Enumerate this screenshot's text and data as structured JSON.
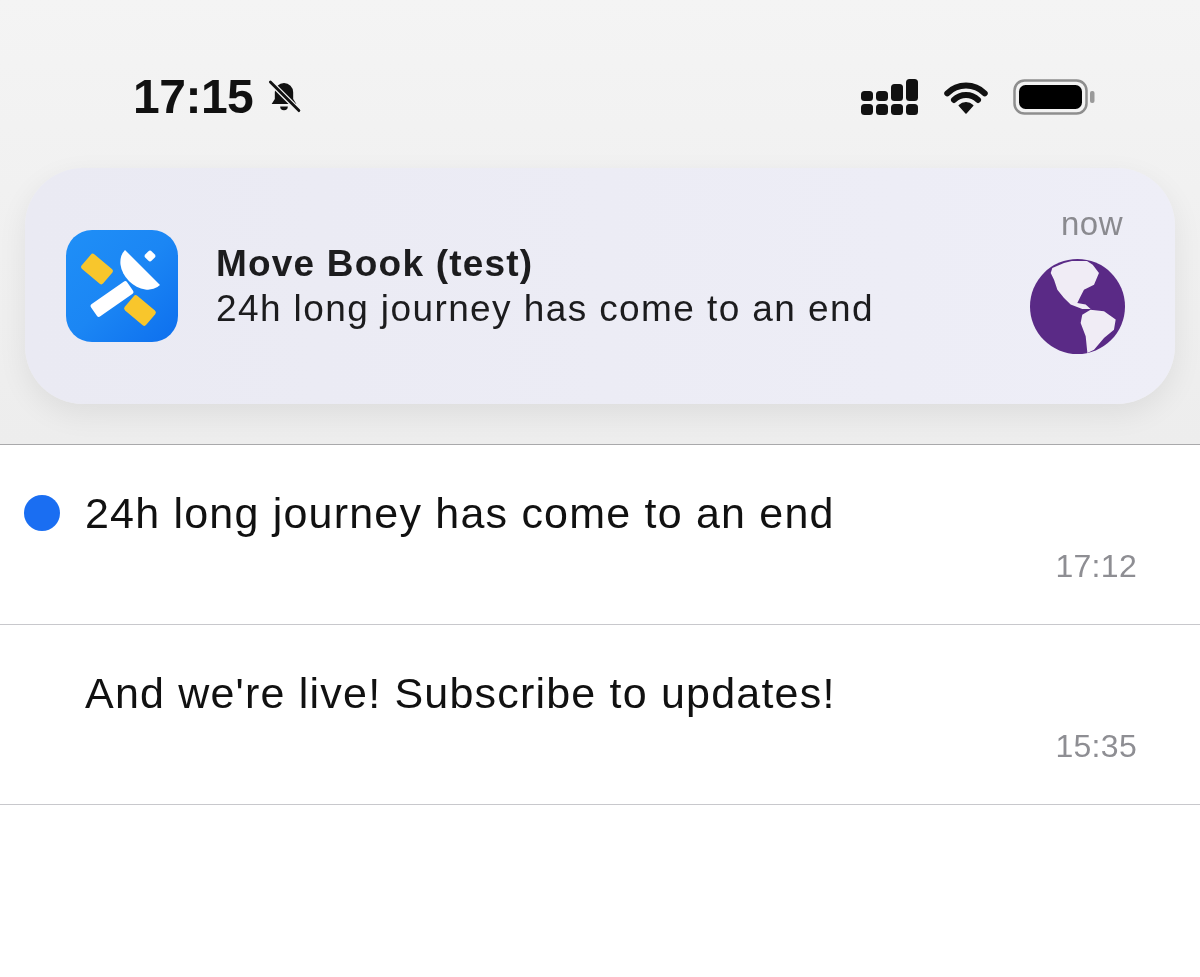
{
  "status_bar": {
    "time": "17:15",
    "silent": true
  },
  "notification": {
    "app_name": "Move Book (test)",
    "body": "24h long journey has come to an end",
    "time": "now"
  },
  "messages": [
    {
      "text": "24h long journey has come to an end",
      "time": "17:12",
      "unread": true
    },
    {
      "text": "And we're live! Subscribe to updates!",
      "time": "15:35",
      "unread": false
    }
  ]
}
